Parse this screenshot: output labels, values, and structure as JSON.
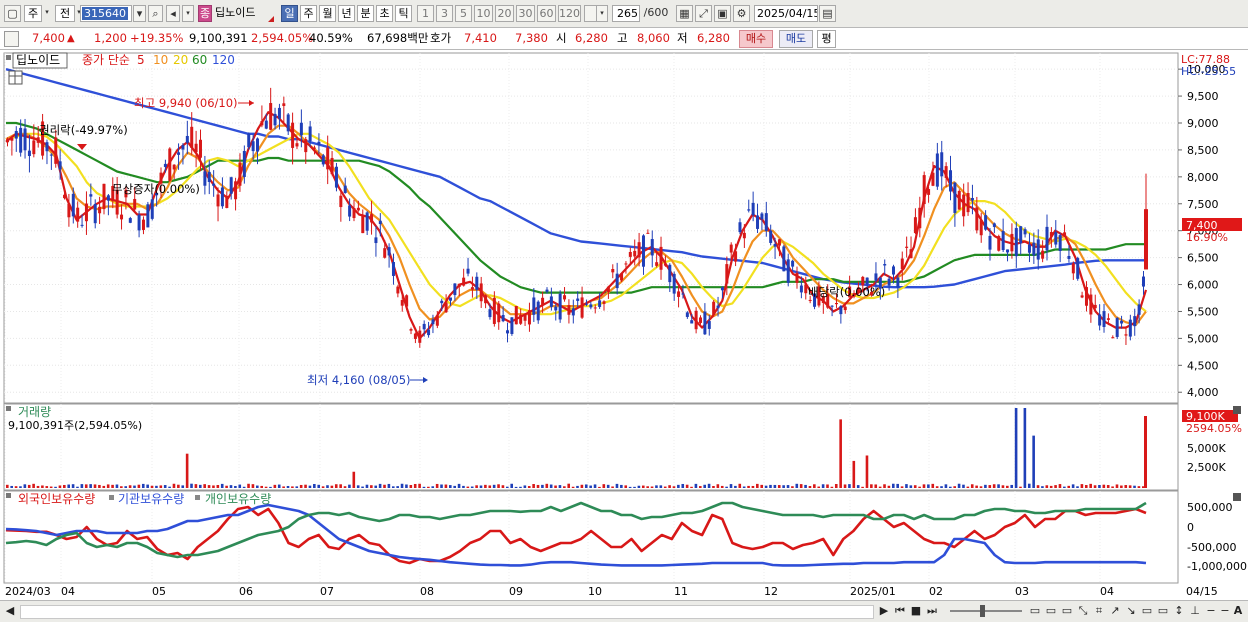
{
  "toolbar": {
    "period_type": "주",
    "compare": "전",
    "code": "315640",
    "badge": "종",
    "name": "딥노이드",
    "periods": [
      "일",
      "주",
      "월",
      "년",
      "분",
      "초",
      "틱"
    ],
    "active_period": "일",
    "intervals": [
      "1",
      "3",
      "5",
      "10",
      "20",
      "30",
      "60",
      "120"
    ],
    "count": "265",
    "count_max": "/600",
    "date": "2025/04/15"
  },
  "quote": {
    "price": "7,400",
    "up_arrow": "▲",
    "change": "1,200",
    "change_pct": "+19.35%",
    "volume": "9,100,391",
    "volume_pct": "2,594.05%",
    "turnover_pct": "40.59%",
    "amount": "67,698백만",
    "hoga_label": "호가",
    "ask": "7,410",
    "bid": "7,380",
    "open_label": "시",
    "open": "6,280",
    "high_label": "고",
    "high": "8,060",
    "low_label": "저",
    "low": "6,280",
    "buy_label": "매수",
    "sell_label": "매도",
    "eval_label": "평"
  },
  "price_panel": {
    "legend_name": "딥노이드",
    "legend_ma_title": "종가 단순",
    "ma_periods": [
      "5",
      "10",
      "20",
      "60",
      "120"
    ],
    "lc": "LC:77.88",
    "hc": "HC:-25.55",
    "y_ticks": [
      "10,000",
      "9,500",
      "9,000",
      "8,500",
      "8,000",
      "7,500",
      "7,000",
      "6,500",
      "6,000",
      "5,500",
      "5,000",
      "4,500",
      "4,000"
    ],
    "current_label": "7,400",
    "current_pct": "16.90%",
    "high_annot": "최고 9,940 (06/10)",
    "low_annot": "최저 4,160 (08/05)",
    "event_1": "권리락(-49.97%)",
    "event_2": "무상증자(0.00%)",
    "event_3": "배당락(0.00%)"
  },
  "volume_panel": {
    "title": "거래량",
    "value": "9,100,391주(2,594.05%)",
    "y_ticks": [
      "5,000K",
      "2,500K"
    ],
    "current_label": "9,100K",
    "current_pct": "2594.05%"
  },
  "holdings_panel": {
    "legend": [
      "외국인보유수량",
      "기관보유수량",
      "개인보유수량"
    ],
    "y_ticks": [
      "500,000",
      "0",
      "-500,000",
      "-1,000,000"
    ]
  },
  "x_axis": {
    "labels": [
      "2024/03",
      "04",
      "05",
      "06",
      "07",
      "08",
      "09",
      "10",
      "11",
      "12",
      "2025/01",
      "02",
      "03",
      "04",
      "04/15"
    ]
  },
  "colors": {
    "up": "#d81818",
    "down": "#1f3fb8",
    "ma5": "#d81818",
    "ma10": "#f09020",
    "ma20": "#f2e020",
    "ma60": "#228b22",
    "ma120": "#2f50d8",
    "foreign": "#d81818",
    "institution": "#2f4fd8",
    "individual": "#2e8b57"
  },
  "chart_data": {
    "type": "candlestick",
    "series": [
      {
        "name": "5",
        "values": [
          8650,
          8800,
          8750,
          8700,
          8600,
          8400,
          7600,
          7200,
          7350,
          7500,
          7600,
          7550,
          7500,
          7300,
          7300,
          7800,
          8200,
          8500,
          8650,
          8400,
          8000,
          7750,
          7600,
          7900,
          8500,
          8900,
          9200,
          9100,
          8900,
          8700,
          8600,
          8400,
          8200,
          7800,
          7500,
          7300,
          7250,
          7000,
          6600,
          6000,
          5400,
          5000,
          5200,
          5500,
          5800,
          6000,
          6050,
          5900,
          5600,
          5400,
          5300,
          5400,
          5500,
          5600,
          5700,
          5600,
          5500,
          5600,
          5700,
          5800,
          6000,
          6200,
          6400,
          6600,
          6700,
          6500,
          6200,
          5900,
          5400,
          5200,
          5400,
          5700,
          6500,
          7000,
          7300,
          7200,
          6900,
          6500,
          6200,
          6100,
          5800,
          5700,
          5500,
          5600,
          5800,
          5900,
          6000,
          6200,
          6100,
          6300,
          6700,
          7600,
          8200,
          8100,
          7700,
          7500,
          7400,
          7100,
          6900,
          6800,
          6750,
          6800,
          6700,
          6700,
          7000,
          6900,
          6500,
          5900,
          5500,
          5300,
          5200,
          5200,
          5300,
          5900
        ]
      },
      {
        "name": "10",
        "values": [
          8700,
          8800,
          8800,
          8700,
          8550,
          8350,
          8000,
          7600,
          7450,
          7400,
          7450,
          7450,
          7500,
          7500,
          7400,
          7500,
          7800,
          8200,
          8450,
          8350,
          8100,
          7900,
          7750,
          7800,
          8200,
          8500,
          8800,
          8950,
          8950,
          8800,
          8600,
          8450,
          8300,
          8000,
          7700,
          7500,
          7350,
          7200,
          6900,
          6500,
          6000,
          5550,
          5350,
          5400,
          5600,
          5800,
          5900,
          5900,
          5750,
          5600,
          5450,
          5450,
          5450,
          5500,
          5600,
          5600,
          5600,
          5600,
          5700,
          5750,
          5900,
          6050,
          6250,
          6450,
          6600,
          6600,
          6450,
          6150,
          5800,
          5500,
          5400,
          5500,
          5900,
          6400,
          6800,
          7000,
          7000,
          6800,
          6500,
          6300,
          6100,
          5900,
          5750,
          5650,
          5650,
          5750,
          5850,
          6000,
          6100,
          6200,
          6450,
          6900,
          7400,
          7800,
          7900,
          7700,
          7500,
          7300,
          7100,
          6950,
          6850,
          6800,
          6750,
          6700,
          6850,
          6900,
          6750,
          6400,
          6000,
          5650,
          5400,
          5300,
          5250,
          5500
        ]
      },
      {
        "name": "20",
        "values": [
          8700,
          8750,
          8800,
          8800,
          8750,
          8600,
          8400,
          8200,
          7900,
          7700,
          7600,
          7500,
          7450,
          7450,
          7450,
          7500,
          7600,
          7750,
          7950,
          8150,
          8300,
          8350,
          8300,
          8200,
          8300,
          8400,
          8500,
          8600,
          8700,
          8800,
          8800,
          8700,
          8600,
          8450,
          8200,
          7900,
          7600,
          7400,
          7200,
          6900,
          6600,
          6300,
          6000,
          5800,
          5650,
          5600,
          5700,
          5800,
          5800,
          5750,
          5650,
          5550,
          5500,
          5450,
          5450,
          5500,
          5550,
          5600,
          5600,
          5650,
          5700,
          5800,
          5950,
          6100,
          6250,
          6400,
          6450,
          6400,
          6200,
          5950,
          5750,
          5600,
          5650,
          5900,
          6200,
          6500,
          6700,
          6800,
          6700,
          6550,
          6400,
          6200,
          6050,
          5900,
          5800,
          5750,
          5750,
          5800,
          5850,
          5950,
          6100,
          6350,
          6700,
          7050,
          7300,
          7450,
          7550,
          7550,
          7500,
          7350,
          7150,
          7000,
          6900,
          6850,
          6800,
          6850,
          6800,
          6700,
          6550,
          6350,
          6100,
          5850,
          5650,
          5500
        ]
      },
      {
        "name": "60",
        "values": [
          9000,
          9000,
          8950,
          8900,
          8800,
          8700,
          8600,
          8500,
          8400,
          8300,
          8200,
          8100,
          8050,
          8000,
          7950,
          7900,
          7900,
          7950,
          8000,
          8100,
          8200,
          8300,
          8300,
          8300,
          8300,
          8300,
          8350,
          8350,
          8300,
          8300,
          8300,
          8300,
          8300,
          8300,
          8300,
          8300,
          8250,
          8200,
          8100,
          7950,
          7800,
          7600,
          7450,
          7250,
          7050,
          6850,
          6650,
          6450,
          6300,
          6150,
          6050,
          5950,
          5900,
          5850,
          5850,
          5850,
          5850,
          5850,
          5850,
          5850,
          5850,
          5850,
          5850,
          5900,
          5950,
          5950,
          5950,
          5950,
          5950,
          5950,
          5950,
          5950,
          5950,
          5950,
          5950,
          5950,
          6000,
          6050,
          6050,
          6050,
          6100,
          6100,
          6100,
          6050,
          6050,
          6050,
          6050,
          6050,
          6050,
          6050,
          6100,
          6150,
          6250,
          6350,
          6450,
          6500,
          6550,
          6550,
          6550,
          6550,
          6550,
          6550,
          6550,
          6600,
          6650,
          6650,
          6650,
          6650,
          6650,
          6650,
          6700,
          6750,
          6750,
          6750
        ]
      },
      {
        "name": "120",
        "values": [
          10000,
          9950,
          9900,
          9850,
          9800,
          9750,
          9700,
          9650,
          9600,
          9550,
          9500,
          9450,
          9400,
          9350,
          9300,
          9250,
          9200,
          9150,
          9100,
          9050,
          9000,
          8950,
          8900,
          8850,
          8800,
          8800,
          8750,
          8750,
          8700,
          8700,
          8650,
          8600,
          8550,
          8500,
          8450,
          8400,
          8350,
          8300,
          8250,
          8200,
          8150,
          8100,
          8050,
          8000,
          7900,
          7800,
          7700,
          7600,
          7550,
          7450,
          7350,
          7250,
          7150,
          7050,
          6950,
          6900,
          6850,
          6800,
          6780,
          6760,
          6740,
          6720,
          6700,
          6680,
          6660,
          6640,
          6620,
          6600,
          6560,
          6520,
          6500,
          6480,
          6460,
          6440,
          6420,
          6400,
          6350,
          6300,
          6250,
          6200,
          6150,
          6100,
          6070,
          6040,
          6020,
          6000,
          5980,
          5960,
          5950,
          5950,
          5950,
          5950,
          5960,
          5980,
          6000,
          6050,
          6100,
          6150,
          6200,
          6250,
          6270,
          6290,
          6310,
          6330,
          6350,
          6370,
          6400,
          6420,
          6440,
          6450,
          6450,
          6450,
          6450,
          6450
        ]
      }
    ],
    "y_range": [
      3800,
      10300
    ],
    "x_start": "2024/03",
    "x_end": "2025/04/15",
    "current_price": 7400,
    "high_point": {
      "date": "06/10",
      "value": 9940
    },
    "low_point": {
      "date": "08/05",
      "value": 4160
    },
    "volume": {
      "last": 9100391,
      "y_ticks_k": [
        2500,
        5000
      ]
    },
    "holdings": {
      "series_names": [
        "외국인보유수량",
        "기관보유수량",
        "개인보유수량"
      ],
      "y_ticks": [
        500000,
        0,
        -500000,
        -1000000
      ]
    }
  }
}
